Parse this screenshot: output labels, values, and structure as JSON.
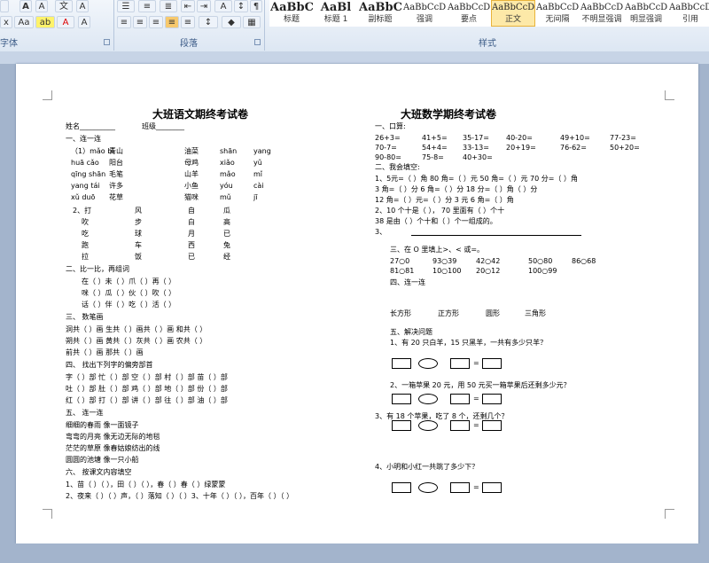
{
  "ribbon": {
    "font_group_label": "字体",
    "paragraph_group_label": "段落",
    "styles_group_label": "样式",
    "styles": [
      {
        "sample": "AaBbC",
        "name": "标题"
      },
      {
        "sample": "AaBl",
        "name": "标题 1"
      },
      {
        "sample": "AaBbC",
        "name": "副标题"
      },
      {
        "sample": "AaBbCcDd",
        "name": "强调"
      },
      {
        "sample": "AaBbCcD",
        "name": "要点"
      },
      {
        "sample": "AaBbCcDd",
        "name": "正文"
      },
      {
        "sample": "AaBbCcDd",
        "name": "无间隔"
      },
      {
        "sample": "AaBbCcDd",
        "name": "不明显强调"
      },
      {
        "sample": "AaBbCcDd",
        "name": "明显强调"
      },
      {
        "sample": "AaBbCcDd",
        "name": "引用"
      }
    ],
    "selected_style_index": 5
  },
  "left": {
    "title": "大班语文期终考试卷",
    "name_label": "姓名__________",
    "class_label": "班级________",
    "s1": "一、连一连",
    "s1_pinyin": [
      [
        "（1）mǎo  bǐ",
        "青山",
        "油菜",
        "shān",
        "yang"
      ],
      [
        "huā  cǎo",
        "阳台",
        "母鸡",
        "xiǎo",
        "yǔ"
      ],
      [
        "qīng  shān",
        "毛笔",
        "山羊",
        "mǎo",
        "mǐ"
      ],
      [
        "yang  tái",
        "许多",
        "小鱼",
        "yóu",
        "cài"
      ],
      [
        "xǔ  duō",
        "花草",
        "猫咪",
        "mǔ",
        "jī"
      ]
    ],
    "s1b": [
      [
        "2、打",
        "风",
        "自",
        "瓜"
      ],
      [
        "吹",
        "步",
        "白",
        "高"
      ],
      [
        "吃",
        "球",
        "月",
        "已"
      ],
      [
        "跑",
        "车",
        "西",
        "兔"
      ],
      [
        "拉",
        "饭",
        "已",
        "经"
      ]
    ],
    "s2": "二、比一比，再组词",
    "s2_rows": [
      "在（    ）未（    ）爪（    ）再（    ）",
      "咪（    ）瓜（    ）伙（    ）吹（    ）",
      "话（    ）伴（    ）吃（    ）活（    ）"
    ],
    "s3": "三、  数笔画",
    "s3_rows": [
      "洞共（ ）画    生共（ ）画共（ ）画    和共（    ）",
      "朔共（ ）画    黄共（ ）灰共（ ）画    农共（    ）",
      "前共（ ）画    那共（ ）画"
    ],
    "s4": "四、  找出下列字的偏旁部首",
    "s4_rows": [
      "字（ ）部  忙（ ）部  空（ ）部  村（ ）部  苗（ ）部",
      "吐（ ）部  肚（ ）部  鸡（ ）部  地（ ）部  份（ ）部",
      "红（ ）部  打（ ）部  讲（ ）部  往（ ）部  油（ ）部"
    ],
    "s5": "五、  连一连",
    "s5_rows": [
      "细细的春雨      像一面镜子",
      "弯弯的月亮      像无边无际的地毯",
      "茫茫的草原      像春姑娘纺出的线",
      "圆圆的池塘    像一只小船"
    ],
    "s6": "六、   按课文内容填空",
    "s6_rows": [
      "1、苗（  ）（ ），田（ ）（ ），春（  ）春（ ）绿蒙蒙",
      "2、夜来（  ）（ ）声，（  ）落知（  ）（  ）3、十年（  ）（  ），百年（ ）（ ）"
    ]
  },
  "right": {
    "title": "大班数学期终考试卷",
    "s1": "一、口算:",
    "calc_rows": [
      [
        "26+3=",
        "41+5=",
        "35-17=",
        "40-20=",
        "49+10=",
        "77-23="
      ],
      [
        "70-7=",
        "54+4=",
        "33-13=",
        "20+19=",
        "76-62=",
        "50+20="
      ],
      [
        "90-80=",
        "75-8=",
        "40+30=",
        "",
        "",
        ""
      ]
    ],
    "s2": "二、我会填空:",
    "fill_rows": [
      "1、5元=（    ）角      80 角=（    ）元      50 角=（    ）元      70 分=（    ）角",
      "    3 角=（    ）分      6 角=（    ）分      18 分=（    ）角（    ）分",
      "    12 角=（    ）元=（    ）分      3 元 6 角=（    ）角",
      "  2、10 个十是（    ），   70 里面有（    ）个十",
      "    38 是由（  ）个十和（  ）个一组成的。",
      "    3、"
    ],
    "s3": "三、在 O 里填上>、<  或=。",
    "cmp_rows": [
      [
        "27○0",
        "93○39",
        "42○42",
        "50○80",
        "86○68"
      ],
      [
        "81○81",
        "10○100",
        "20○12",
        "100○99",
        ""
      ]
    ],
    "s4": "四、连一连",
    "shapes": [
      "长方形",
      "正方形",
      "圆形",
      "三角形"
    ],
    "s5": "五、解决问题",
    "problems": [
      "1、有 20 只白羊，15 只黑羊，一共有多少只羊？",
      "2、一箱苹果 20 元，用 50 元买一箱苹果后还剩多少元？",
      "3、有 18 个苹果，吃了 8 个，还剩几个？",
      "4、小明和小红一共跳了多少下？"
    ],
    "equals": "="
  }
}
